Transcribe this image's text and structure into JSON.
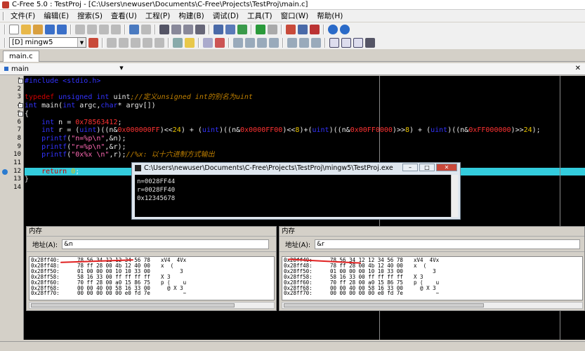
{
  "window": {
    "title": "C-Free 5.0 : TestProj - [C:\\Users\\newuser\\Documents\\C-Free\\Projects\\TestProj\\main.c]"
  },
  "menu": [
    "文件(F)",
    "编辑(E)",
    "搜索(S)",
    "查看(U)",
    "工程(P)",
    "构建(B)",
    "调试(D)",
    "工具(T)",
    "窗口(W)",
    "帮助(H)"
  ],
  "toolbar": {
    "compiler_select": "[D] mingw5"
  },
  "tabs": {
    "file_tab": "main.c"
  },
  "function_bar": {
    "selected": "main"
  },
  "editor": {
    "line_numbers": [
      "1",
      "2",
      "3",
      "4",
      "5",
      "6",
      "7",
      "8",
      "9",
      "10",
      "11",
      "12",
      "13",
      "14"
    ],
    "lines": [
      {
        "parts": [
          [
            "ty",
            "#include <stdio.h>"
          ]
        ]
      },
      {
        "parts": []
      },
      {
        "parts": [
          [
            "kw",
            "typedef "
          ],
          [
            "ty",
            "unsigned int "
          ],
          [
            "id",
            "uint"
          ],
          [
            "cm",
            ";//定义unsigned int的别名为uint"
          ]
        ]
      },
      {
        "parts": [
          [
            "ty",
            "int "
          ],
          [
            "id",
            "main("
          ],
          [
            "ty",
            "int "
          ],
          [
            "id",
            "argc,"
          ],
          [
            "ty",
            "char"
          ],
          [
            "id",
            "* argv[])"
          ]
        ]
      },
      {
        "parts": [
          [
            "id",
            "{"
          ]
        ]
      },
      {
        "parts": [
          [
            "ty",
            "    int "
          ],
          [
            "id",
            "n = "
          ],
          [
            "hx",
            "0x78563412"
          ],
          [
            "id",
            ";"
          ]
        ]
      },
      {
        "parts": [
          [
            "ty",
            "    int "
          ],
          [
            "id",
            "r = ("
          ],
          [
            "ty",
            "uint"
          ],
          [
            "id",
            ")((n&"
          ],
          [
            "hx",
            "0x000000FF"
          ],
          [
            "id",
            ")<<"
          ],
          [
            "nm",
            "24"
          ],
          [
            "id",
            ") + ("
          ],
          [
            "ty",
            "uint"
          ],
          [
            "id",
            ")((n&"
          ],
          [
            "hx",
            "0x0000FF00"
          ],
          [
            "id",
            ")<<"
          ],
          [
            "nm",
            "8"
          ],
          [
            "id",
            ")+("
          ],
          [
            "ty",
            "uint"
          ],
          [
            "id",
            ")((n&"
          ],
          [
            "hx",
            "0x00FF0000"
          ],
          [
            "id",
            ")>>"
          ],
          [
            "nm",
            "8"
          ],
          [
            "id",
            ") + ("
          ],
          [
            "ty",
            "uint"
          ],
          [
            "id",
            ")((n&"
          ],
          [
            "hx",
            "0xFF000000"
          ],
          [
            "id",
            ")>>"
          ],
          [
            "nm",
            "24"
          ],
          [
            "id",
            ");"
          ]
        ]
      },
      {
        "parts": [
          [
            "ty",
            "    printf"
          ],
          [
            "id",
            "("
          ],
          [
            "st",
            "\"n=%p\\n\""
          ],
          [
            "id",
            ",&n);"
          ]
        ]
      },
      {
        "parts": [
          [
            "ty",
            "    printf"
          ],
          [
            "id",
            "("
          ],
          [
            "st",
            "\"r=%p\\n\""
          ],
          [
            "id",
            ",&r);"
          ]
        ]
      },
      {
        "parts": [
          [
            "ty",
            "    printf"
          ],
          [
            "id",
            "("
          ],
          [
            "st",
            "\"0x%x \\n\""
          ],
          [
            "id",
            ",r);"
          ],
          [
            "cm",
            "//%x: 以十六进制方式输出"
          ]
        ]
      },
      {
        "parts": []
      },
      {
        "parts": [
          [
            "kw",
            "    return "
          ],
          [
            "nm",
            "0"
          ],
          [
            "id",
            ";"
          ]
        ]
      },
      {
        "parts": [
          [
            "id",
            "}"
          ]
        ]
      },
      {
        "parts": []
      }
    ]
  },
  "console": {
    "title": "C:\\Users\\newuser\\Documents\\C-Free\\Projects\\TestProj\\mingw5\\TestProj.exe",
    "output": [
      "n=0028FF44",
      "r=0028FF40",
      "0x12345678"
    ]
  },
  "memory_left": {
    "title": "内存",
    "address_label": "地址(A):",
    "address_value": "&n",
    "rows": [
      [
        "0x28ff40:",
        "78 56 34 12 12 34 56 78",
        "xV4  4Vx"
      ],
      [
        "0x28ff48:",
        "78 ff 28 00 4b 12 40 00",
        "x  (   "
      ],
      [
        "0x28ff50:",
        "01 00 00 00 10 10 33 00",
        "      3 "
      ],
      [
        "0x28ff58:",
        "58 16 33 00 ff ff ff ff",
        "X 3    "
      ],
      [
        "0x28ff60:",
        "70 ff 28 00 a0 15 86 75",
        "p (    u"
      ],
      [
        "0x28ff68:",
        "00 00 40 00 58 16 33 00",
        "  @ X 3 "
      ],
      [
        "0x28ff70:",
        "00 00 00 00 00 e0 fd 7e",
        "       ~"
      ]
    ]
  },
  "memory_right": {
    "title": "内存",
    "address_label": "地址(A):",
    "address_value": "&r",
    "rows": [
      [
        "0x28ff40:",
        "78 56 34 12 12 34 56 78",
        "xV4  4Vx"
      ],
      [
        "0x28ff48:",
        "78 ff 28 00 4b 12 40 00",
        "x  (   "
      ],
      [
        "0x28ff50:",
        "01 00 00 00 10 10 33 00",
        "      3 "
      ],
      [
        "0x28ff58:",
        "58 16 33 00 ff ff ff ff",
        "X 3    "
      ],
      [
        "0x28ff60:",
        "70 ff 28 00 a0 15 86 75",
        "p (    u"
      ],
      [
        "0x28ff68:",
        "00 00 40 00 58 16 33 00",
        "  @ X 3 "
      ],
      [
        "0x28ff70:",
        "00 00 00 00 00 e0 fd 7e",
        "       ~"
      ]
    ]
  },
  "colors": {
    "highlight_line": "#33ccdd",
    "annotation": "#e02020"
  }
}
